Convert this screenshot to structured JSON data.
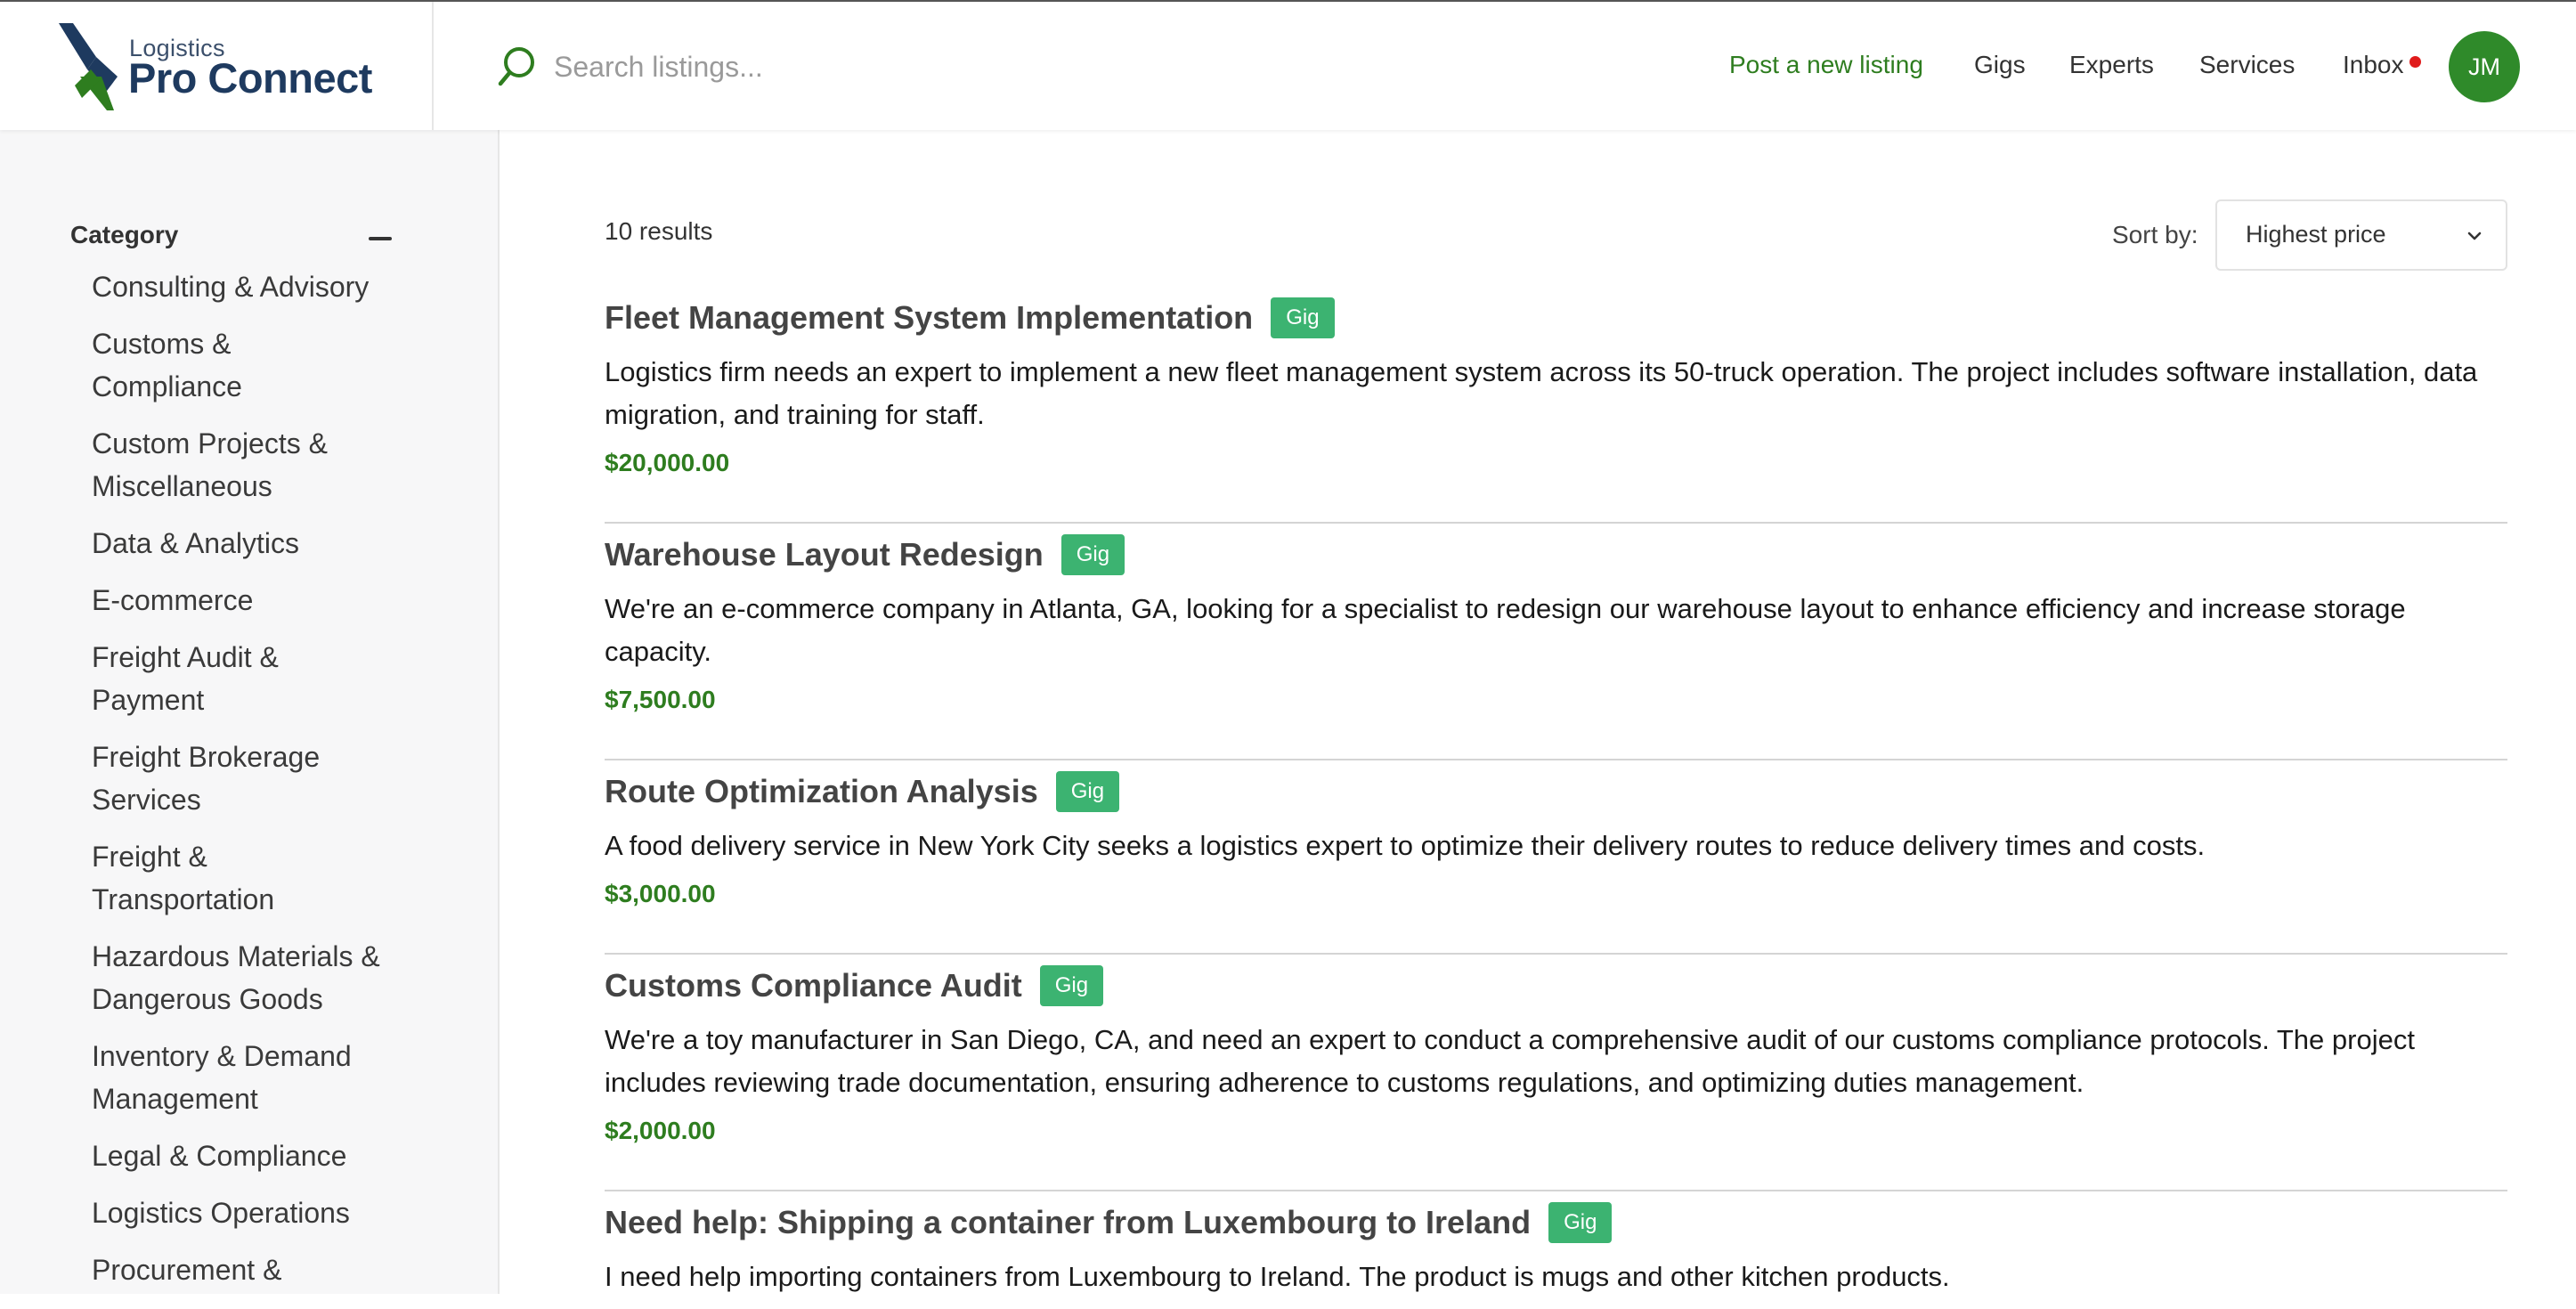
{
  "brand": {
    "small": "Logistics",
    "big": "Pro Connect"
  },
  "search": {
    "placeholder": "Search listings..."
  },
  "nav": {
    "post_listing": "Post a new listing",
    "gigs": "Gigs",
    "experts": "Experts",
    "services": "Services",
    "inbox": "Inbox",
    "avatar_initials": "JM"
  },
  "sidebar": {
    "heading": "Category",
    "categories": [
      [
        "Consulting & Advisory"
      ],
      [
        "Customs &",
        "Compliance"
      ],
      [
        "Custom Projects &",
        "Miscellaneous"
      ],
      [
        "Data & Analytics"
      ],
      [
        "E-commerce"
      ],
      [
        "Freight Audit &",
        "Payment"
      ],
      [
        "Freight Brokerage",
        "Services"
      ],
      [
        "Freight &",
        "Transportation"
      ],
      [
        "Hazardous Materials &",
        "Dangerous Goods"
      ],
      [
        "Inventory & Demand",
        "Management"
      ],
      [
        "Legal & Compliance"
      ],
      [
        "Logistics Operations"
      ],
      [
        "Procurement &"
      ]
    ]
  },
  "results": {
    "count_label": "10 results",
    "sort_label": "Sort by:",
    "sort_value": "Highest price"
  },
  "listings": [
    {
      "title": "Fleet Management System Implementation",
      "badge": "Gig",
      "description": "Logistics firm needs an expert to implement a new fleet management system across its 50-truck operation. The project includes software installation, data migration, and training for staff.",
      "price": "$20,000.00"
    },
    {
      "title": "Warehouse Layout Redesign",
      "badge": "Gig",
      "description": "We're an e-commerce company in Atlanta, GA, looking for a specialist to redesign our warehouse layout to enhance efficiency and increase storage capacity.",
      "price": "$7,500.00"
    },
    {
      "title": "Route Optimization Analysis",
      "badge": "Gig",
      "description": "A food delivery service in New York City seeks a logistics expert to optimize their delivery routes to reduce delivery times and costs.",
      "price": "$3,000.00"
    },
    {
      "title": "Customs Compliance Audit",
      "badge": "Gig",
      "description": "We're a toy manufacturer in San Diego, CA, and need an expert to conduct a comprehensive audit of our customs compliance protocols. The project includes reviewing trade documentation, ensuring adherence to customs regulations, and optimizing duties management.",
      "price": "$2,000.00"
    },
    {
      "title": "Need help: Shipping a container from Luxembourg to Ireland",
      "badge": "Gig",
      "description": "I need help importing containers from Luxembourg to Ireland. The product is mugs and other kitchen products.",
      "price": ""
    }
  ],
  "colors": {
    "accent_green": "#2e7d1f",
    "badge_green": "#3cb371",
    "avatar_green": "#2f8a2a",
    "brand_navy": "#1e3a5f",
    "notification_red": "#e01b1b"
  },
  "icons": [
    "logo-mark-icon",
    "search-icon",
    "notification-dot-icon",
    "collapse-minus-icon",
    "chevron-down-icon"
  ]
}
